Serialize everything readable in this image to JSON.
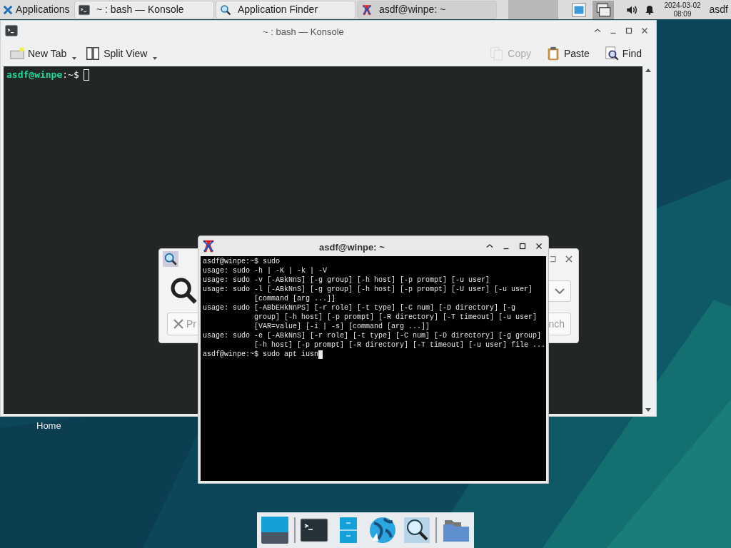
{
  "panel": {
    "menu_label": "Applications",
    "tasks": [
      {
        "title": "~ : bash — Konsole",
        "kind": "konsole",
        "selected": false
      },
      {
        "title": "Application Finder",
        "kind": "finder",
        "selected": false
      },
      {
        "title": "asdf@winpe: ~",
        "kind": "xterm",
        "selected": true
      }
    ],
    "date": "2024-03-02",
    "time": "08:09",
    "user": "asdf"
  },
  "desktop_icons": [
    {
      "label": "Home"
    }
  ],
  "konsole": {
    "title": "~ : bash — Konsole",
    "toolbar_left": [
      {
        "label": "New Tab",
        "kind": "newtab",
        "disabled": false
      },
      {
        "label": "Split View",
        "kind": "split",
        "disabled": false
      }
    ],
    "toolbar_right": [
      {
        "label": "Copy",
        "kind": "copy",
        "disabled": true
      },
      {
        "label": "Paste",
        "kind": "paste",
        "disabled": false
      },
      {
        "label": "Find",
        "kind": "find",
        "disabled": false
      }
    ],
    "prompt_user": "asdf@winpe",
    "prompt_path": ":~$"
  },
  "finder": {
    "left_button": "Pr",
    "right_button": "nch"
  },
  "xterm": {
    "title": "asdf@winpe: ~",
    "lines": [
      "asdf@winpe:~$ sudo",
      "usage: sudo -h | -K | -k | -V",
      "usage: sudo -v [-ABkNnS] [-g group] [-h host] [-p prompt] [-u user]",
      "usage: sudo -l [-ABkNnS] [-g group] [-h host] [-p prompt] [-U user] [-u user]",
      "            [command [arg ...]]",
      "usage: sudo [-ABbEHkNnPS] [-r role] [-t type] [-C num] [-D directory] [-g",
      "            group] [-h host] [-p prompt] [-R directory] [-T timeout] [-u user]",
      "            [VAR=value] [-i | -s] [command [arg ...]]",
      "usage: sudo -e [-ABkNnS] [-r role] [-t type] [-C num] [-D directory] [-g group]",
      "            [-h host] [-p prompt] [-R directory] [-T timeout] [-u user] file ...",
      "asdf@winpe:~$ sudo apt iusn"
    ]
  },
  "dock": [
    {
      "kind": "desktop"
    },
    {
      "kind": "terminal"
    },
    {
      "kind": "cabinet"
    },
    {
      "kind": "globe"
    },
    {
      "kind": "finder"
    },
    {
      "kind": "folder"
    }
  ]
}
